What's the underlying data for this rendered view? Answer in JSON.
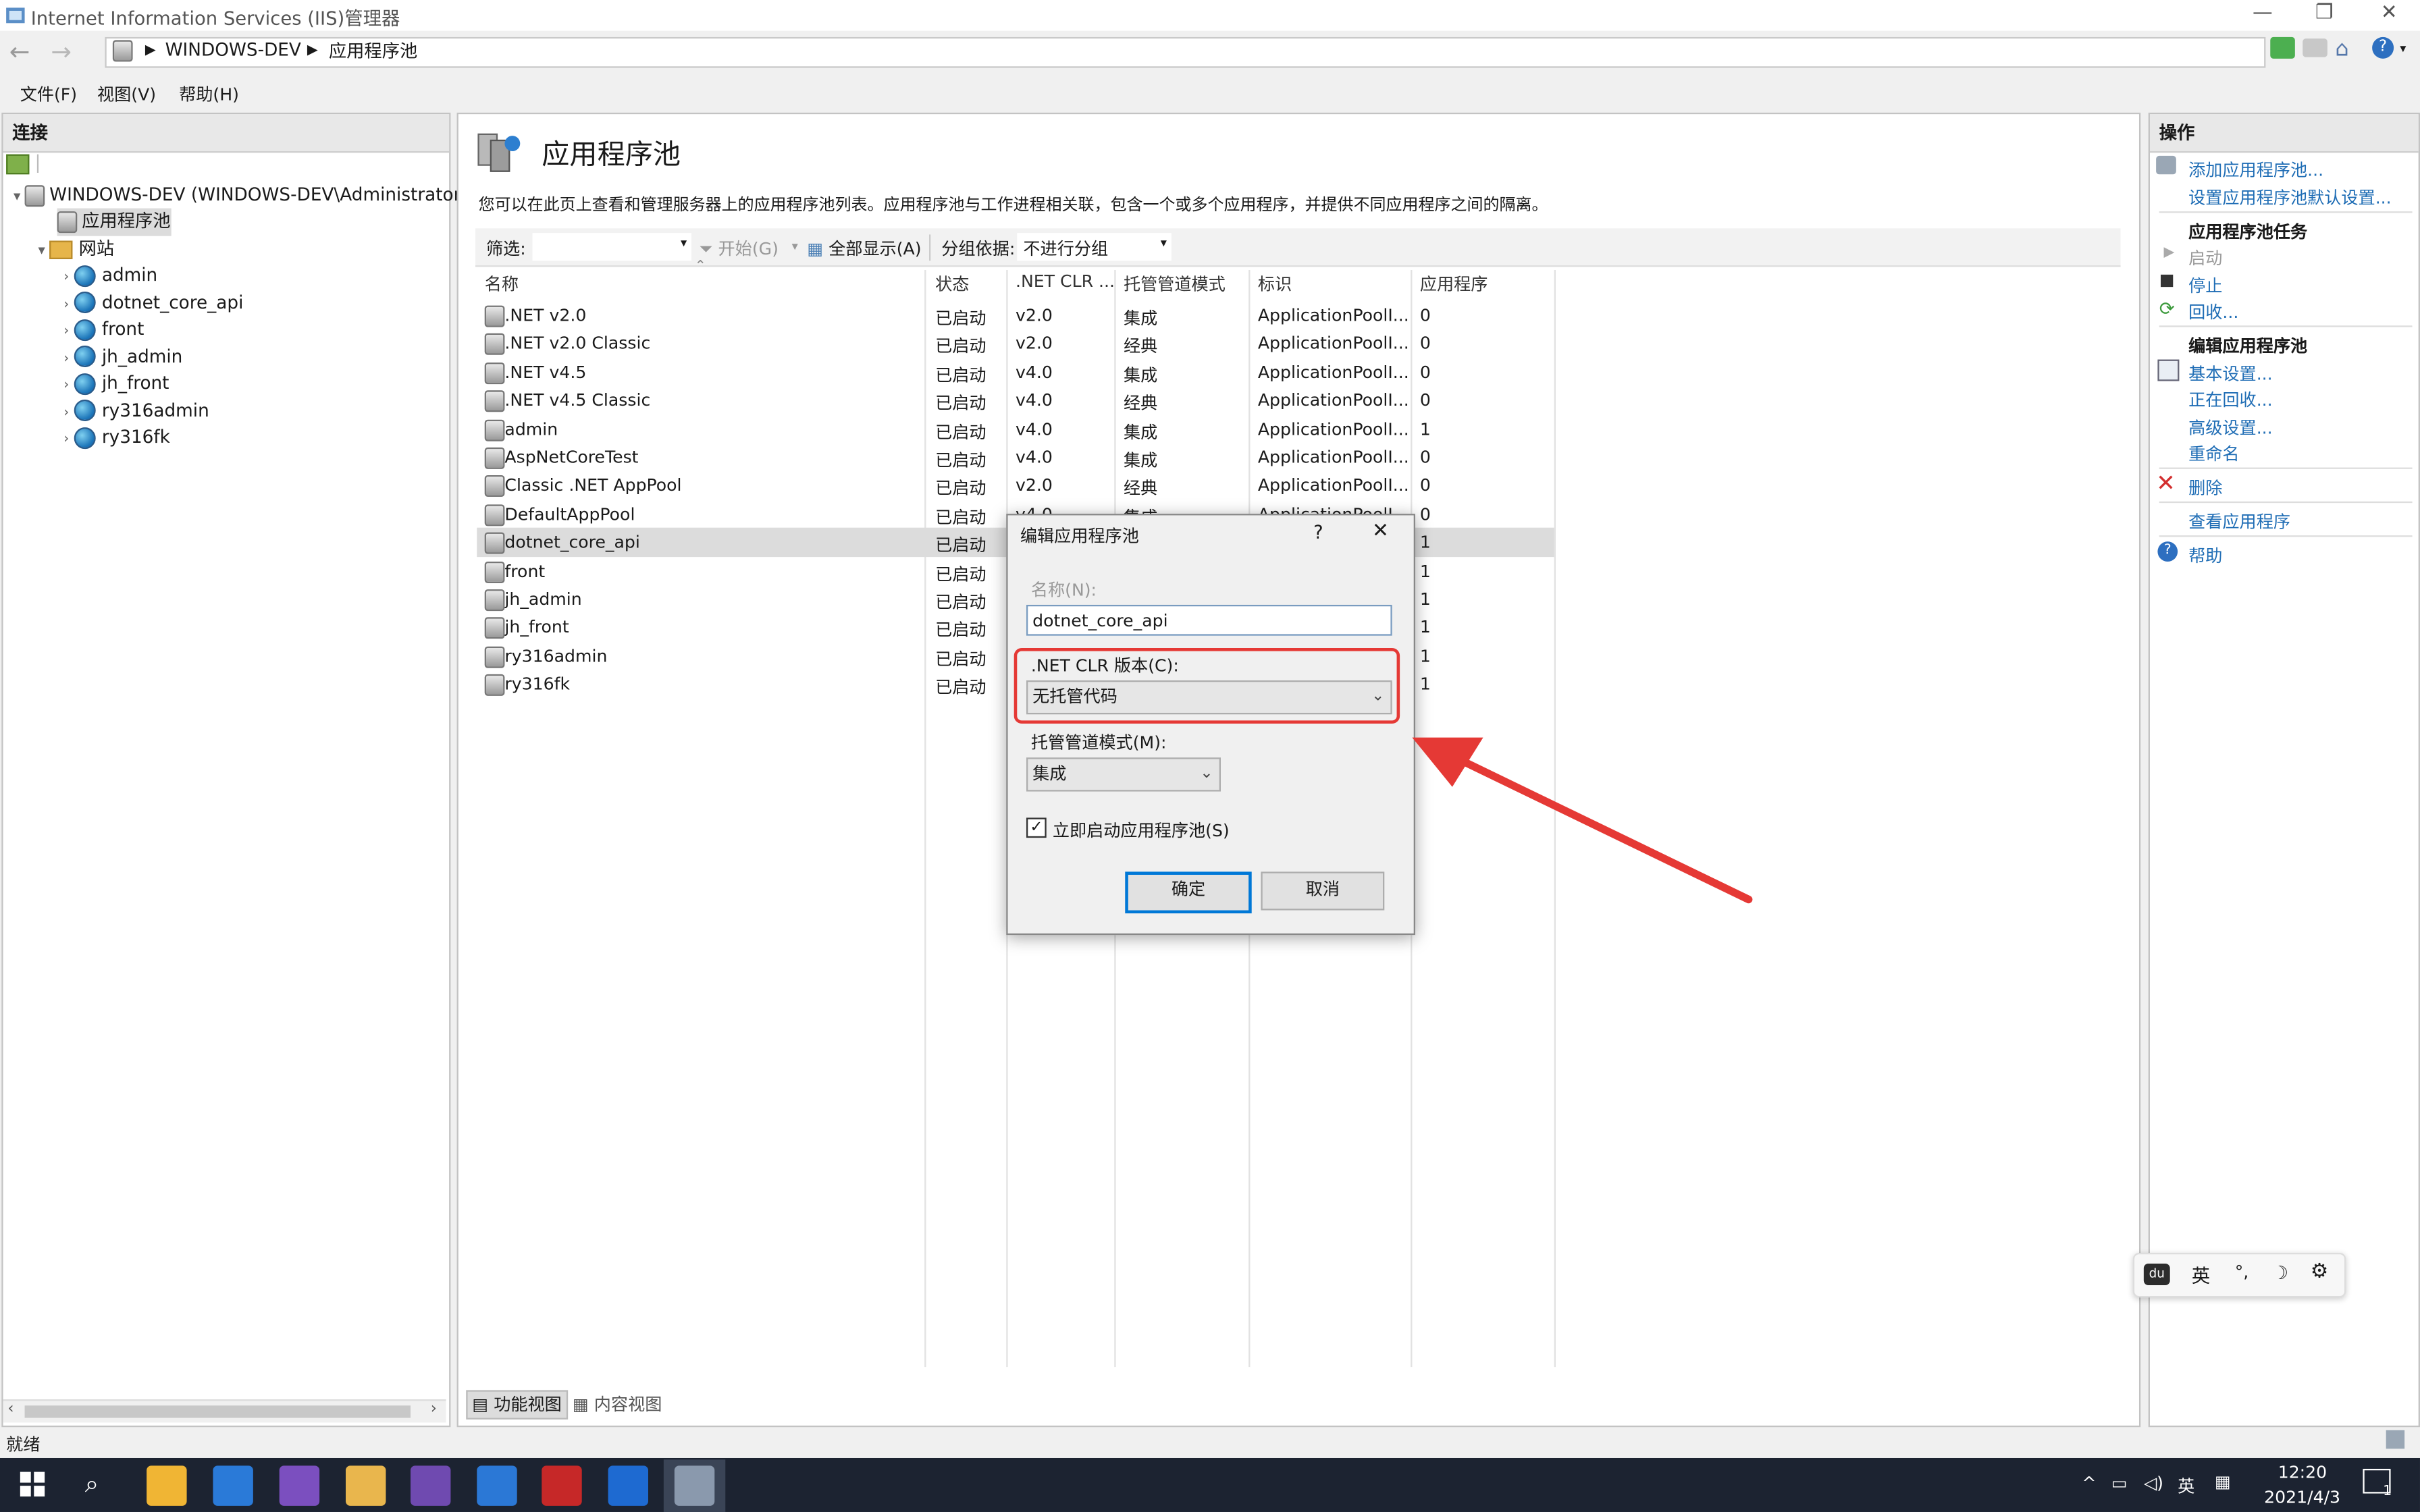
{
  "window": {
    "title": "Internet Information Services (IIS)管理器"
  },
  "address": {
    "crumbs": [
      "WINDOWS-DEV",
      "应用程序池"
    ]
  },
  "menu": {
    "file": "文件(F)",
    "view": "视图(V)",
    "help": "帮助(H)"
  },
  "connections": {
    "header": "连接",
    "server": "WINDOWS-DEV (WINDOWS-DEV\\Administrator)",
    "app_pools": "应用程序池",
    "sites": "网站",
    "site_list": [
      "admin",
      "dotnet_core_api",
      "front",
      "jh_admin",
      "jh_front",
      "ry316admin",
      "ry316fk"
    ]
  },
  "main": {
    "title": "应用程序池",
    "description": "您可以在此页上查看和管理服务器上的应用程序池列表。应用程序池与工作进程相关联，包含一个或多个应用程序，并提供不同应用程序之间的隔离。",
    "filter_label": "筛选:",
    "start_label": "开始(G)",
    "show_all_label": "全部显示(A)",
    "group_by_label": "分组依据:",
    "group_by_value": "不进行分组",
    "columns": {
      "name": "名称",
      "status": "状态",
      "clr": ".NET CLR ...",
      "pipeline": "托管管道模式",
      "identity": "标识",
      "apps": "应用程序"
    },
    "rows": [
      {
        "name": ".NET v2.0",
        "status": "已启动",
        "clr": "v2.0",
        "pipeline": "集成",
        "identity": "ApplicationPoolI...",
        "apps": "0"
      },
      {
        "name": ".NET v2.0 Classic",
        "status": "已启动",
        "clr": "v2.0",
        "pipeline": "经典",
        "identity": "ApplicationPoolI...",
        "apps": "0"
      },
      {
        "name": ".NET v4.5",
        "status": "已启动",
        "clr": "v4.0",
        "pipeline": "集成",
        "identity": "ApplicationPoolI...",
        "apps": "0"
      },
      {
        "name": ".NET v4.5 Classic",
        "status": "已启动",
        "clr": "v4.0",
        "pipeline": "经典",
        "identity": "ApplicationPoolI...",
        "apps": "0"
      },
      {
        "name": "admin",
        "status": "已启动",
        "clr": "v4.0",
        "pipeline": "集成",
        "identity": "ApplicationPoolI...",
        "apps": "1"
      },
      {
        "name": "AspNetCoreTest",
        "status": "已启动",
        "clr": "v4.0",
        "pipeline": "集成",
        "identity": "ApplicationPoolI...",
        "apps": "0"
      },
      {
        "name": "Classic .NET AppPool",
        "status": "已启动",
        "clr": "v2.0",
        "pipeline": "经典",
        "identity": "ApplicationPoolI...",
        "apps": "0"
      },
      {
        "name": "DefaultAppPool",
        "status": "已启动",
        "clr": "v4.0",
        "pipeline": "集成",
        "identity": "ApplicationPoolI...",
        "apps": "0"
      },
      {
        "name": "dotnet_core_api",
        "status": "已启动",
        "clr": "",
        "pipeline": "",
        "identity": "",
        "apps": "1"
      },
      {
        "name": "front",
        "status": "已启动",
        "clr": "",
        "pipeline": "",
        "identity": "",
        "apps": "1"
      },
      {
        "name": "jh_admin",
        "status": "已启动",
        "clr": "",
        "pipeline": "",
        "identity": "",
        "apps": "1"
      },
      {
        "name": "jh_front",
        "status": "已启动",
        "clr": "",
        "pipeline": "",
        "identity": "",
        "apps": "1"
      },
      {
        "name": "ry316admin",
        "status": "已启动",
        "clr": "",
        "pipeline": "",
        "identity": "",
        "apps": "1"
      },
      {
        "name": "ry316fk",
        "status": "已启动",
        "clr": "",
        "pipeline": "",
        "identity": "",
        "apps": "1"
      }
    ],
    "tab_features": "功能视图",
    "tab_content": "内容视图"
  },
  "actions": {
    "header": "操作",
    "add_pool": "添加应用程序池...",
    "set_defaults": "设置应用程序池默认设置...",
    "tasks_header": "应用程序池任务",
    "start": "启动",
    "stop": "停止",
    "recycle": "回收...",
    "edit_header": "编辑应用程序池",
    "basic": "基本设置...",
    "recycling": "正在回收...",
    "advanced": "高级设置...",
    "rename": "重命名",
    "delete": "删除",
    "view_apps": "查看应用程序",
    "help": "帮助"
  },
  "dialog": {
    "title": "编辑应用程序池",
    "help_glyph": "?",
    "name_label": "名称(N):",
    "name_value": "dotnet_core_api",
    "clr_label": ".NET CLR 版本(C):",
    "clr_value": "无托管代码",
    "pipeline_label": "托管管道模式(M):",
    "pipeline_value": "集成",
    "autostart_label": "立即启动应用程序池(S)",
    "autostart_checked": true,
    "ok": "确定",
    "cancel": "取消"
  },
  "ime": {
    "lang": "英",
    "punct": "°,",
    "moon": "☽"
  },
  "status": {
    "text": "就绪"
  },
  "taskbar": {
    "ime": "英",
    "time": "12:20",
    "date": "2021/4/3",
    "notif": "1"
  },
  "colors": {
    "highlight": "#e53935",
    "link": "#1f6db5",
    "taskbar": "#1c2331"
  }
}
